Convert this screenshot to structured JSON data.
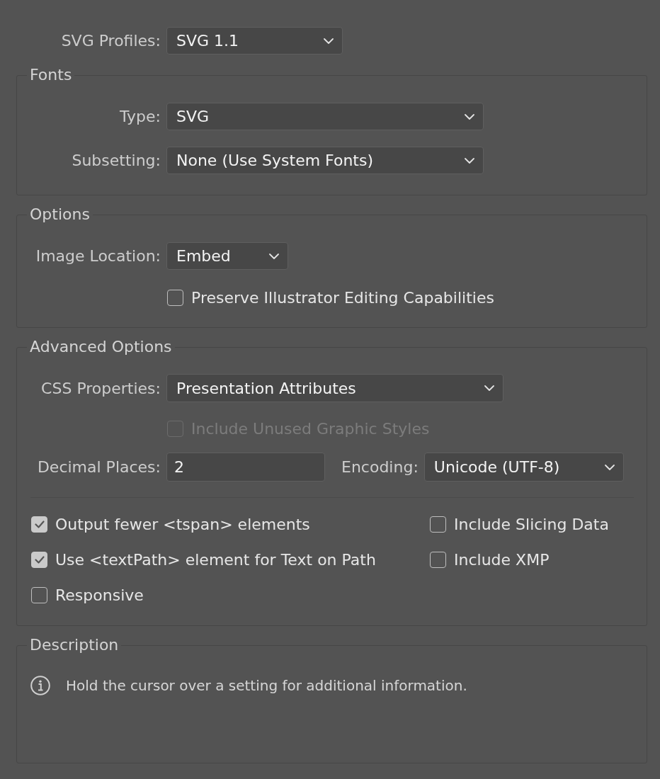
{
  "profile": {
    "label": "SVG Profiles:",
    "value": "SVG 1.1"
  },
  "fonts": {
    "title": "Fonts",
    "type": {
      "label": "Type:",
      "value": "SVG"
    },
    "subsetting": {
      "label": "Subsetting:",
      "value": "None (Use System Fonts)"
    }
  },
  "options": {
    "title": "Options",
    "image_location": {
      "label": "Image Location:",
      "value": "Embed"
    },
    "preserve_editing": {
      "label": "Preserve Illustrator Editing Capabilities",
      "checked": false,
      "disabled": false
    }
  },
  "advanced_options": {
    "title": "Advanced Options",
    "css_properties": {
      "label": "CSS Properties:",
      "value": "Presentation Attributes"
    },
    "include_unused_styles": {
      "label": "Include Unused Graphic Styles",
      "checked": false,
      "disabled": true
    },
    "decimal_places": {
      "label": "Decimal Places:",
      "value": "2"
    },
    "encoding": {
      "label": "Encoding:",
      "value": "Unicode (UTF-8)"
    },
    "checkboxes": [
      {
        "label": "Output fewer <tspan> elements",
        "checked": true,
        "disabled": false
      },
      {
        "label": "Include Slicing Data",
        "checked": false,
        "disabled": false
      },
      {
        "label": "Use <textPath> element for Text on Path",
        "checked": true,
        "disabled": false
      },
      {
        "label": "Include XMP",
        "checked": false,
        "disabled": false
      },
      {
        "label": "Responsive",
        "checked": false,
        "disabled": false
      }
    ]
  },
  "description": {
    "title": "Description",
    "text": "Hold the cursor over a setting for additional information."
  }
}
